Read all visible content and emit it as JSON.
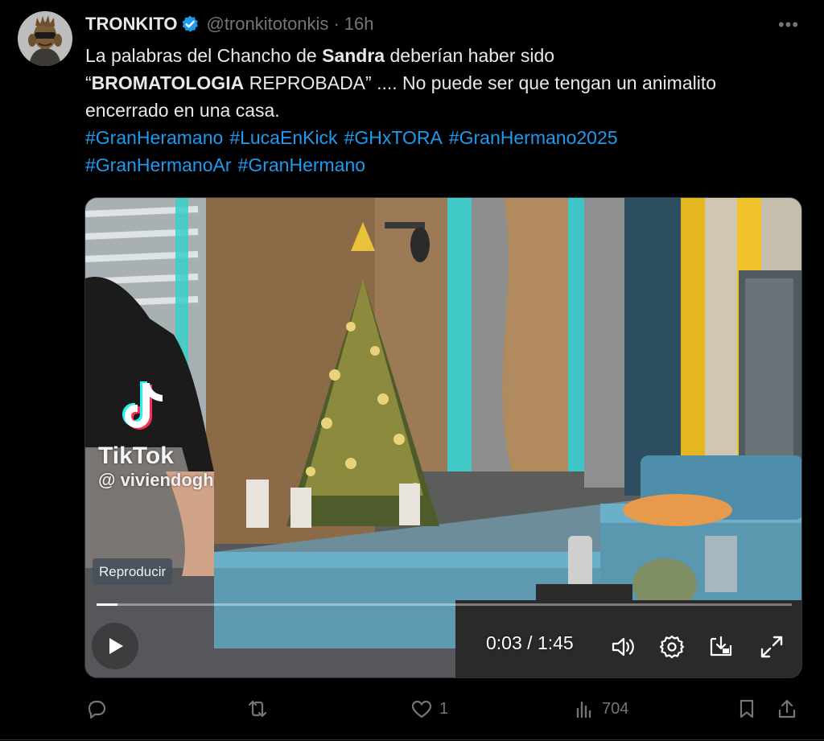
{
  "author": {
    "display_name": "TRONKITO",
    "handle": "@tronkitotonkis",
    "separator": "·",
    "time": "16h",
    "verified_icon": "verified-badge-icon",
    "avatar_icon": "groot-avatar-icon"
  },
  "more_label": "•••",
  "text": {
    "l1_a": "La palabras del Chancho de ",
    "l1_b": "Sandra",
    "l1_c": " deberían haber sido",
    "l2_a": "“",
    "l2_b": "BROMATOLOGIA",
    "l2_c": " REPROBADA” .... No puede ser que tengan un animalito",
    "l3": "encerrado en una casa.",
    "hashtags_row1": [
      "#GranHeramano",
      "#LucaEnKick",
      "#GHxTORA",
      "#GranHermano2025"
    ],
    "hashtags_row2": [
      "#GranHermanoAr",
      "#GranHermano"
    ]
  },
  "video": {
    "watermark_brand": "TikTok",
    "watermark_user": "@ viviendogh",
    "reproducir_label": "Reproducir",
    "current_time": "0:03",
    "time_separator": " / ",
    "duration": "1:45",
    "progress_fraction": 0.03,
    "controls": [
      "play-icon",
      "volume-icon",
      "settings-icon",
      "picture-in-picture-icon",
      "fullscreen-icon"
    ]
  },
  "actions": {
    "reply_count": "",
    "retweet_count": "",
    "like_count": "1",
    "views_count": "704"
  },
  "colors": {
    "background": "#000000",
    "link": "#1d9bf0",
    "secondary_text": "#71767b",
    "verified": "#1d9bf0"
  }
}
